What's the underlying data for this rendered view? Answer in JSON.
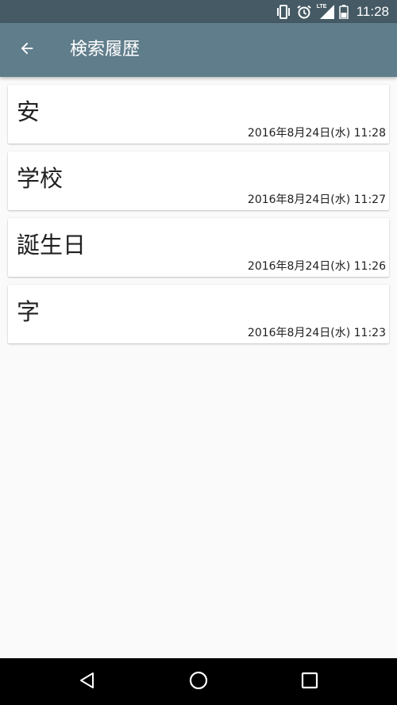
{
  "status_bar": {
    "time": "11:28",
    "icons": [
      "vibrate-icon",
      "alarm-icon",
      "lte-signal-icon",
      "battery-icon"
    ],
    "lte_label": "LTE"
  },
  "app_bar": {
    "title": "検索履歴",
    "back_icon": "arrow-back-icon"
  },
  "history": {
    "items": [
      {
        "word": "安",
        "timestamp": "2016年8月24日(水) 11:28"
      },
      {
        "word": "学校",
        "timestamp": "2016年8月24日(水) 11:27"
      },
      {
        "word": "誕生日",
        "timestamp": "2016年8月24日(水) 11:26"
      },
      {
        "word": "字",
        "timestamp": "2016年8月24日(水) 11:23"
      }
    ]
  },
  "nav_bar": {
    "icons": [
      "back-triangle-icon",
      "home-circle-icon",
      "recents-square-icon"
    ]
  },
  "colors": {
    "status_bar": "#455a64",
    "app_bar": "#607d8b",
    "background": "#fafafa",
    "card": "#ffffff",
    "text": "#212121"
  }
}
